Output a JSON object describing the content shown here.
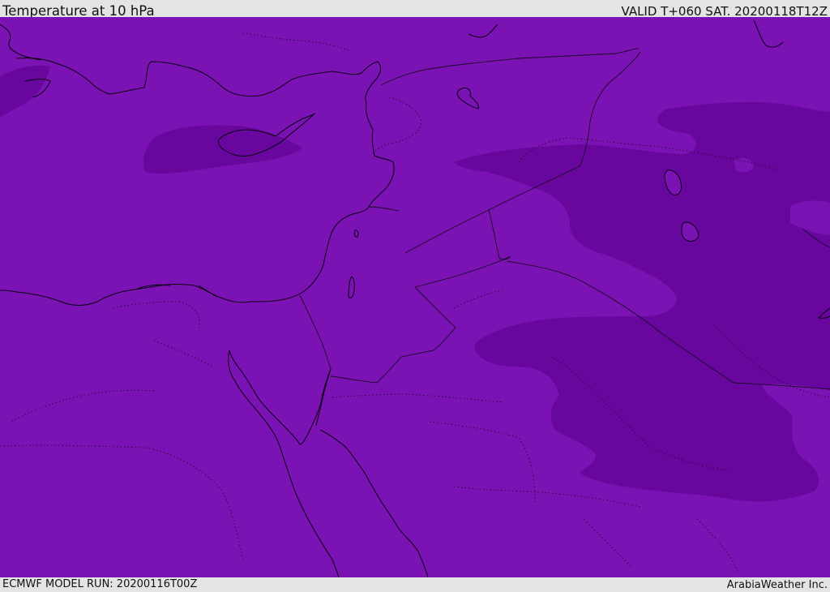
{
  "header": {
    "title": "Temperature at 10 hPa",
    "valid": "VALID T+060 SAT. 20200118T12Z"
  },
  "footer": {
    "model_run": "ECMWF MODEL RUN: 20200116T00Z",
    "credit": "ArabiaWeather Inc."
  },
  "colors": {
    "base_fill": "#7b12b3",
    "cold_fill": "#68079e",
    "coastline": "#0a0010",
    "frame": "#e4e4e4"
  }
}
